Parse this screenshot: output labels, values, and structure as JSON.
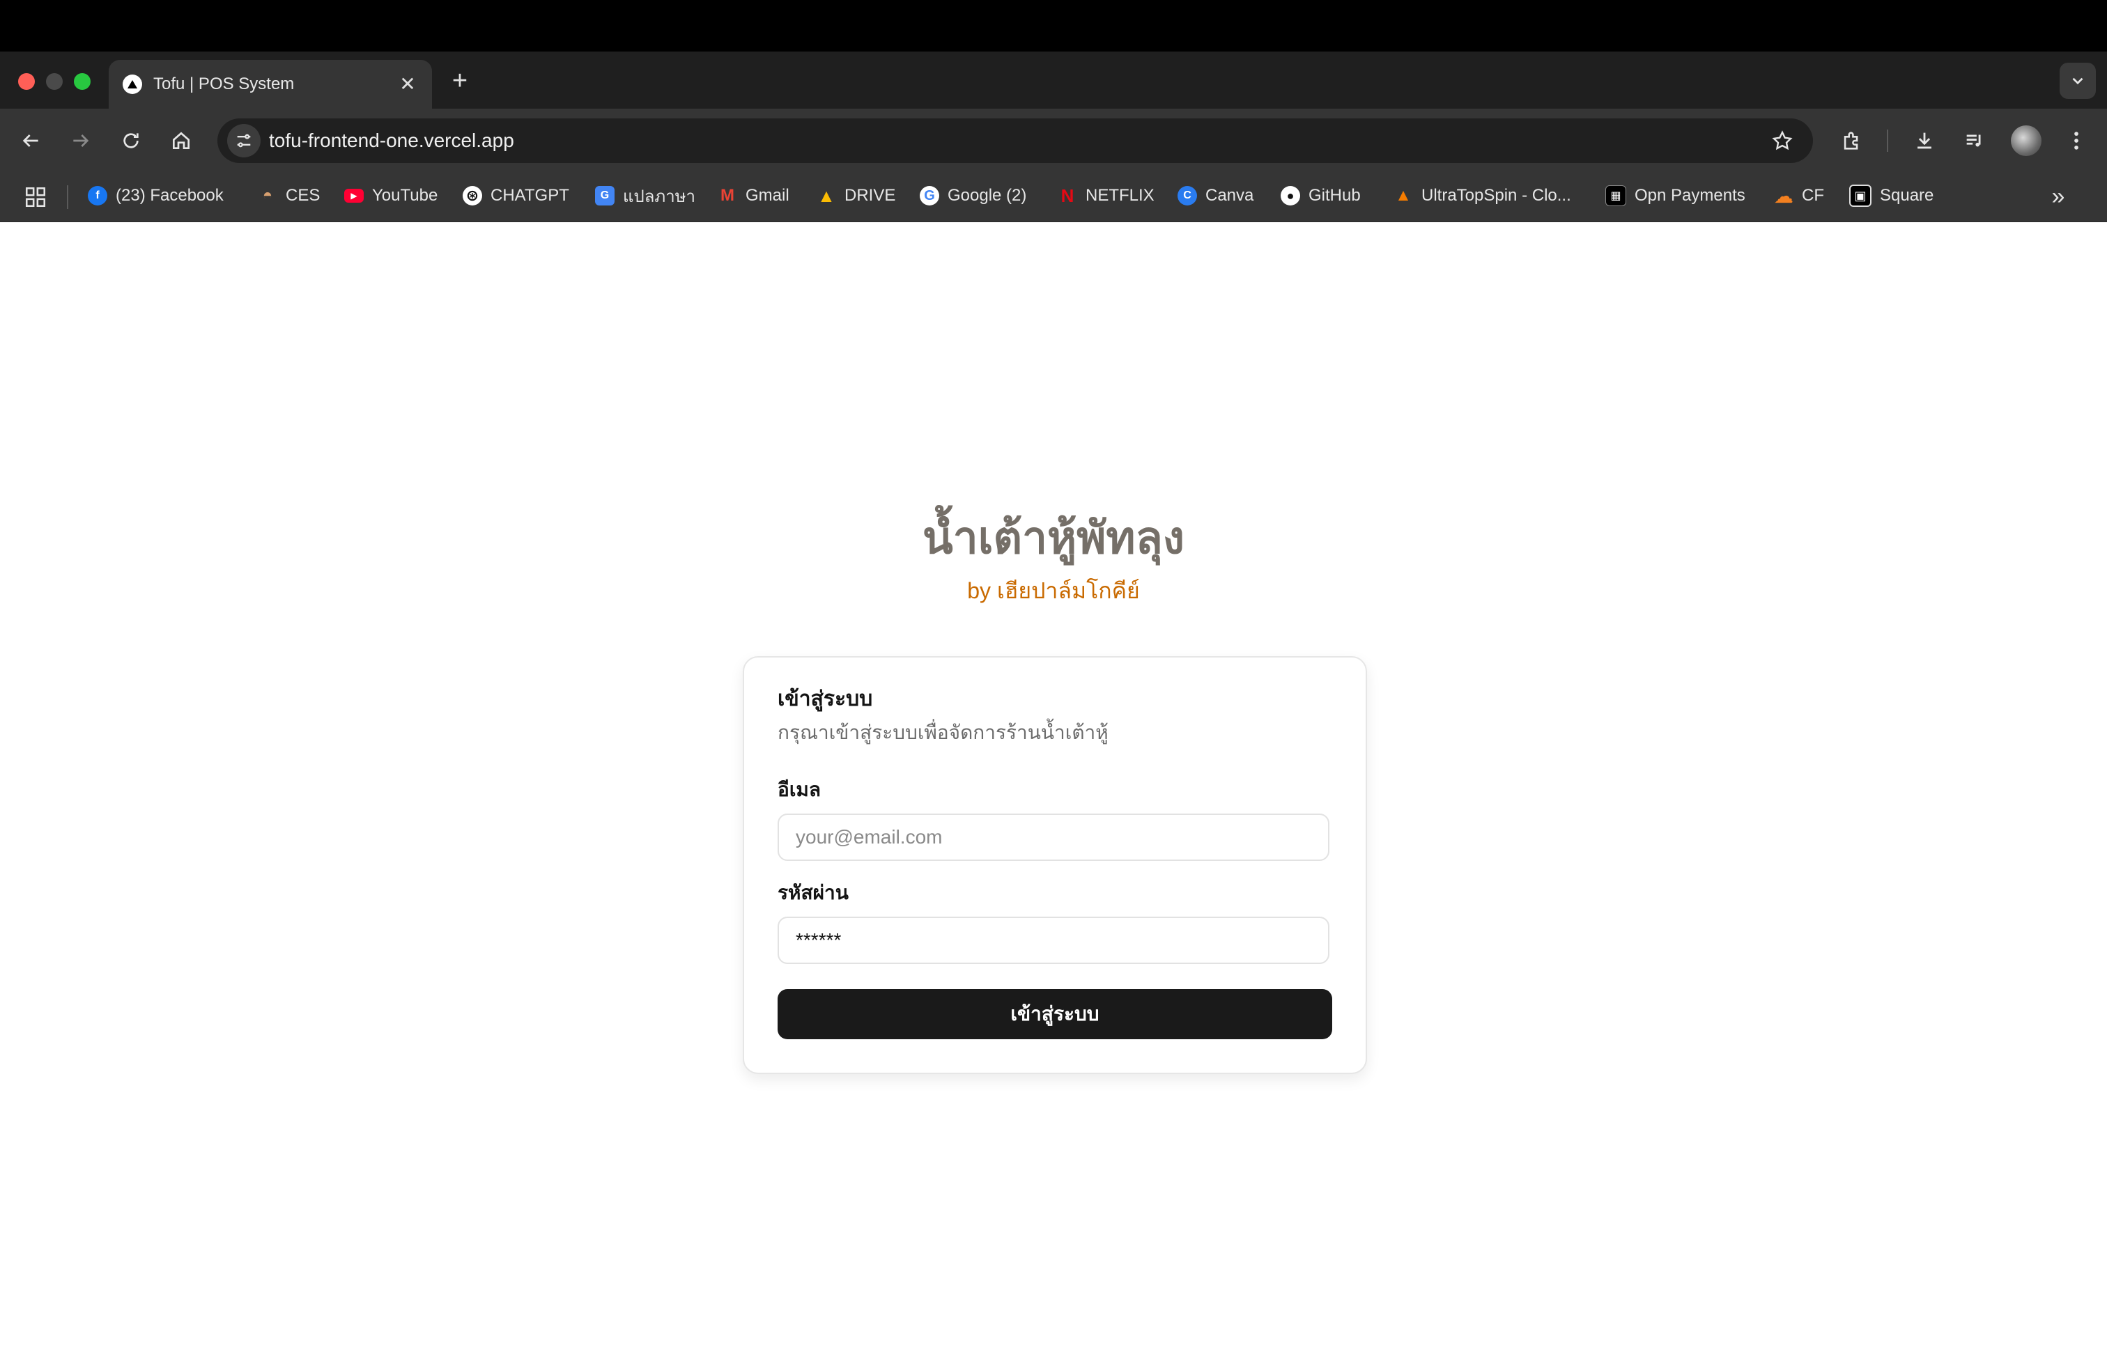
{
  "browser": {
    "tab": {
      "title": "Tofu | POS System",
      "close_glyph": "✕"
    },
    "new_tab_glyph": "+",
    "address_bar": {
      "url": "tofu-frontend-one.vercel.app"
    },
    "bookmarks": [
      {
        "label": "(23) Facebook",
        "icon": "facebook-icon",
        "color": "#1877f2",
        "glyph": "f"
      },
      {
        "label": "CES",
        "icon": "ces-icon",
        "color": "#b07040",
        "glyph": "◓"
      },
      {
        "label": "YouTube",
        "icon": "youtube-icon",
        "color": "#ff0033",
        "glyph": "▶"
      },
      {
        "label": "CHATGPT",
        "icon": "chatgpt-icon",
        "color": "#ffffff",
        "glyph": "⊛"
      },
      {
        "label": "แปลภาษา",
        "icon": "translate-icon",
        "color": "#4285f4",
        "glyph": "G"
      },
      {
        "label": "Gmail",
        "icon": "gmail-icon",
        "color": "#ea4335",
        "glyph": "M"
      },
      {
        "label": "DRIVE",
        "icon": "drive-icon",
        "color": "#34a853",
        "glyph": "▲"
      },
      {
        "label": "Google (2)",
        "icon": "google-icon",
        "color": "#ffffff",
        "glyph": "G"
      },
      {
        "label": "NETFLIX",
        "icon": "netflix-icon",
        "color": "#e50914",
        "glyph": "N"
      },
      {
        "label": "Canva",
        "icon": "canva-icon",
        "color": "#7d2ae8",
        "glyph": "C"
      },
      {
        "label": "GitHub",
        "icon": "github-icon",
        "color": "#ffffff",
        "glyph": "●"
      },
      {
        "label": "UltraTopSpin - Clo...",
        "icon": "ultratopspin-icon",
        "color": "#f57c00",
        "glyph": "▲"
      },
      {
        "label": "Opn Payments",
        "icon": "opn-payments-icon",
        "color": "#000000",
        "glyph": "▦"
      },
      {
        "label": "CF",
        "icon": "cloudflare-icon",
        "color": "#f38020",
        "glyph": "☁"
      },
      {
        "label": "Square",
        "icon": "square-icon",
        "color": "#000000",
        "glyph": "▣"
      }
    ],
    "more_bookmarks_glyph": "»"
  },
  "page": {
    "brand_title": "น้ำเต้าหู้พัทลุง",
    "brand_subtitle": "by เฮียปาล์มโกคีย์",
    "login_card": {
      "title": "เข้าสู่ระบบ",
      "description": "กรุณาเข้าสู่ระบบเพื่อจัดการร้านน้ำเต้าหู้",
      "email_label": "อีเมล",
      "email_placeholder": "your@email.com",
      "email_value": "",
      "password_label": "รหัสผ่าน",
      "password_placeholder": "••••••",
      "password_value": "******",
      "submit_label": "เข้าสู่ระบบ"
    }
  },
  "colors": {
    "brand_title": "#756f68",
    "brand_subtitle": "#c96a00",
    "button_bg": "#1a1a1a"
  }
}
